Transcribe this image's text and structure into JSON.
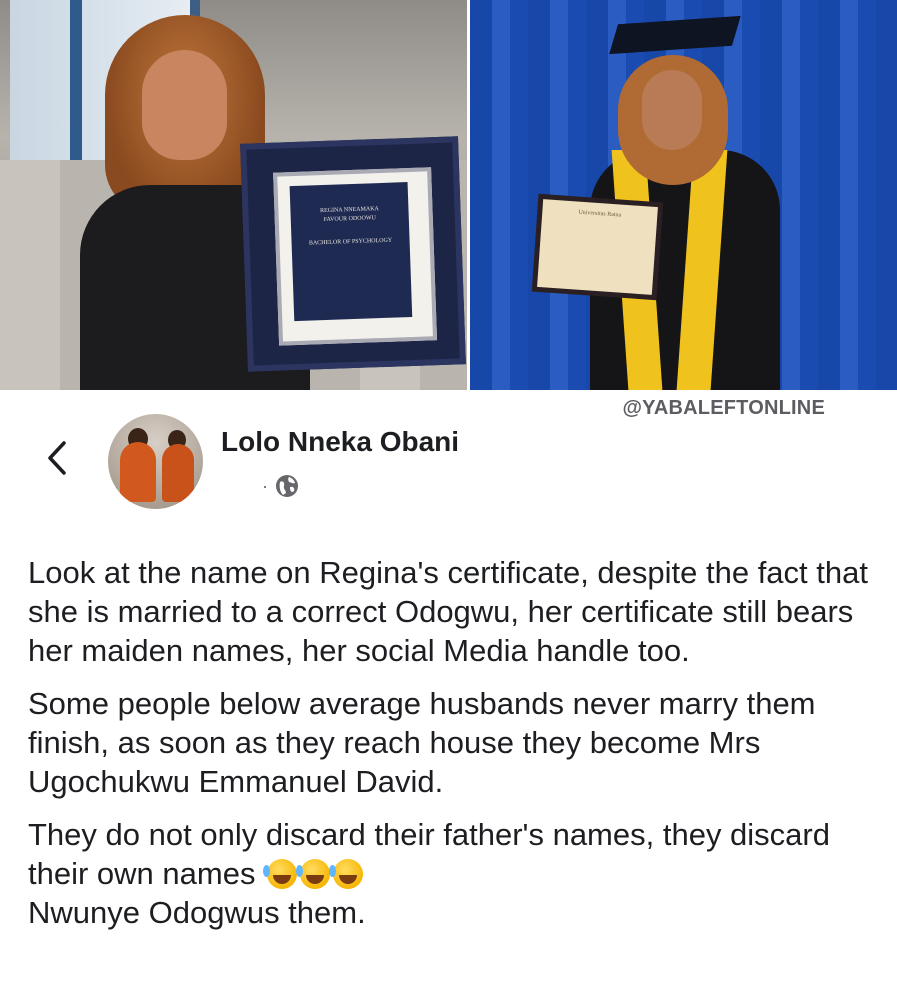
{
  "watermark": "@YABALEFTONLINE",
  "photos": {
    "left_certificate_lines": [
      "REGINA NNEAMAKA",
      "FAVOUR ODOOWU",
      "BACHELOR OF PSYCHOLOGY"
    ],
    "right_certificate_title": "Universitas Ratna"
  },
  "post": {
    "author": "Lolo Nneka Obani",
    "meta_dot": "·",
    "paragraphs": [
      "Look at the name on Regina's certificate, despite the fact that she is married to a correct Odogwu, her certificate still bears her maiden names, her social Media handle too.",
      "Some people below average husbands never marry them finish, as soon as they reach house they become Mrs Ugochukwu Emmanuel David.",
      "They do not only discard their father's names, they discard their own names"
    ],
    "last_line": "Nwunye Odogwus them.",
    "emoji_name": "rolling-on-floor-laughing"
  },
  "icons": {
    "back": "chevron-left-icon",
    "privacy": "globe-icon"
  }
}
